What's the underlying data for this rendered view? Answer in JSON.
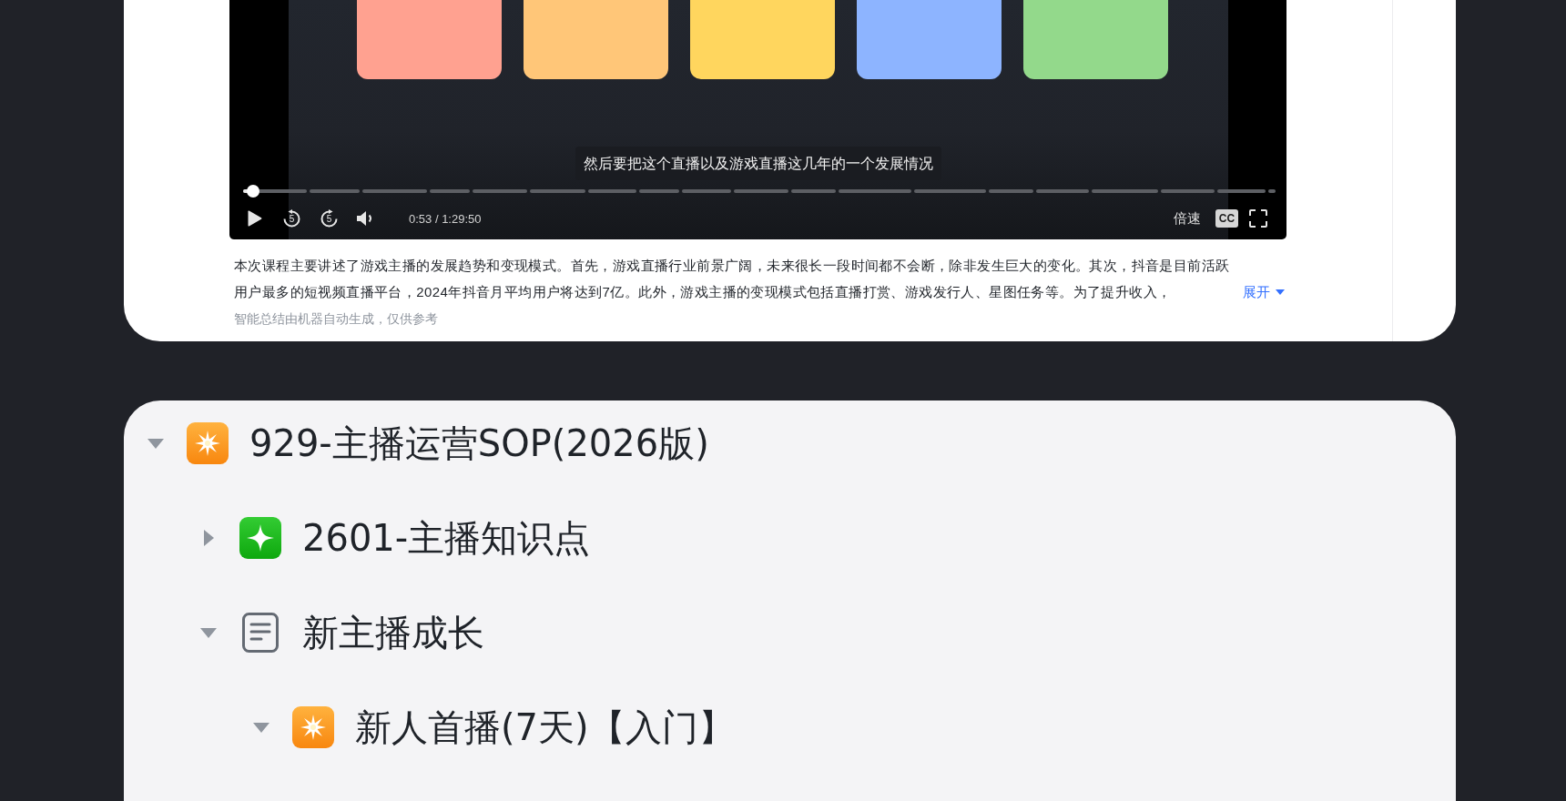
{
  "player": {
    "subtitle": "然后要把这个直播以及游戏直播这几年的一个发展情况",
    "progress": {
      "level": 0.01
    },
    "playing": false,
    "skip_back": "5",
    "skip_forward": "5",
    "muted": false,
    "time": "0:53 / 1:29:50",
    "speed_label": "倍速",
    "captions_label": "CC"
  },
  "summary": {
    "text": "本次课程主要讲述了游戏主播的发展趋势和变现模式。首先，游戏直播行业前景广阔，未来很长一段时间都不会断，除非发生巨大的变化。其次，抖音是目前活跃用户最多的短视频直播平台，2024年抖音月平均用户将达到7亿。此外，游戏主播的变现模式包括直播打赏、游戏发行人、星图任务等。为了提升收入，",
    "expand_label": "展开",
    "note": "智能总结由机器自动生成，仅供参考"
  },
  "tree": [
    {
      "label": "929-主播运营SOP(2026版)",
      "kind": "star",
      "expanded": true,
      "children": [
        {
          "label": "2601-主播知识点",
          "kind": "sparkle",
          "expanded": false
        },
        {
          "label": "新主播成长",
          "kind": "page",
          "expanded": true,
          "children": [
            {
              "label": "新人首播(7天)【入门】",
              "kind": "star",
              "expanded": true
            }
          ]
        }
      ]
    }
  ]
}
